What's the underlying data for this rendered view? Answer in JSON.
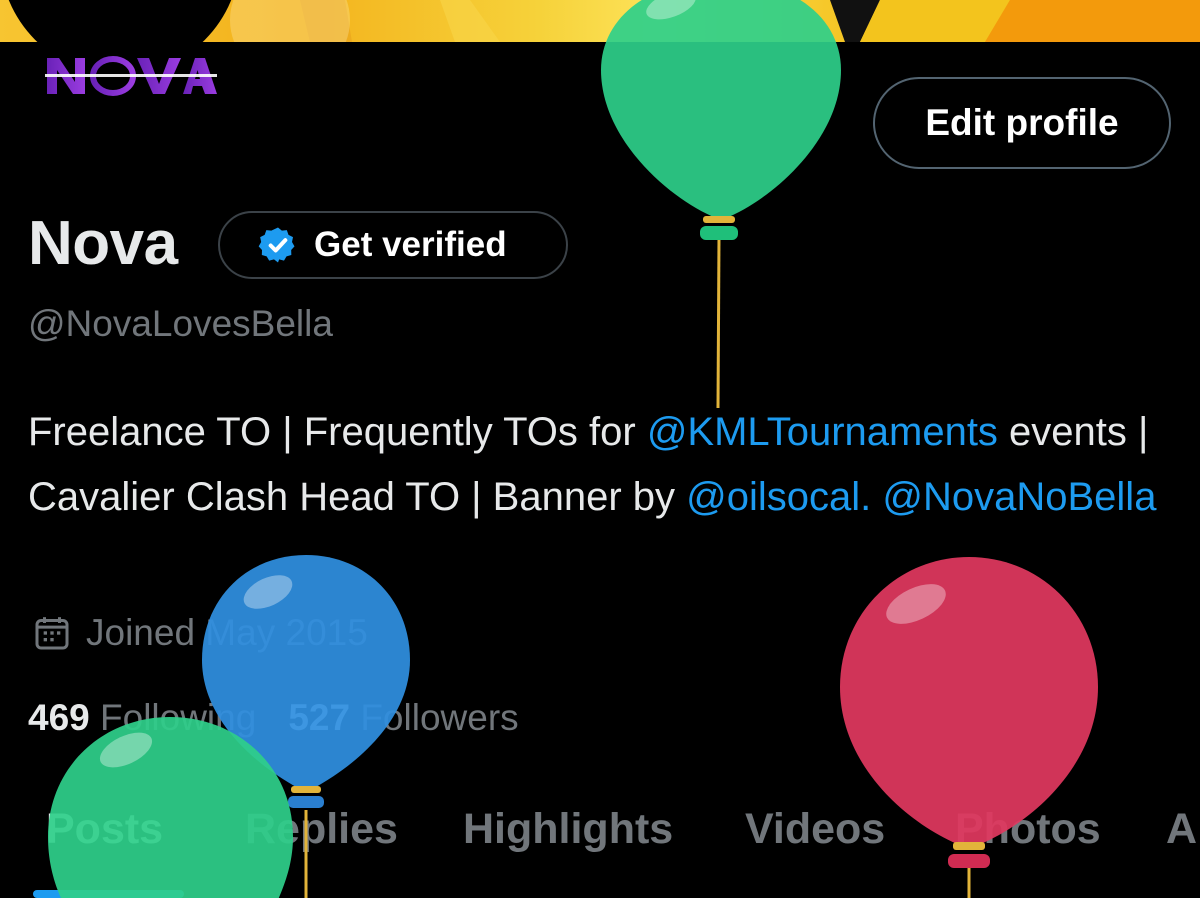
{
  "profile": {
    "display_name": "Nova",
    "handle": "@NovaLovesBella",
    "logo_text": "NOVA",
    "edit_profile_label": "Edit profile",
    "verify_label": "Get verified",
    "bio": {
      "text_1": "Freelance TO | Frequently TOs for ",
      "mention_1": "@KMLTournaments",
      "text_2": " events | Cavalier Clash Head TO | Banner by ",
      "mention_2": "@oilsocal",
      "text_3": ". ",
      "mention_3": "@NovaNoBella"
    },
    "joined": "Joined May 2015",
    "following_count": "469",
    "following_label": "Following",
    "followers_count": "527",
    "followers_label": "Followers"
  },
  "tabs": [
    {
      "label": "Posts",
      "active": true
    },
    {
      "label": "Replies",
      "active": false
    },
    {
      "label": "Highlights",
      "active": false
    },
    {
      "label": "Videos",
      "active": false
    },
    {
      "label": "Photos",
      "active": false
    },
    {
      "label": "A",
      "active": false
    }
  ],
  "icons": {
    "verified": "verified-badge-icon",
    "calendar": "calendar-icon",
    "balloons": [
      "green-balloon",
      "blue-balloon",
      "green-balloon",
      "red-balloon"
    ]
  },
  "colors": {
    "accent": "#1d9bf0",
    "muted": "#71767b",
    "text": "#e7e9ea",
    "logo_purple": "#7b2fc8",
    "balloon_green": "#2ecf8a",
    "balloon_blue": "#2f8fe0",
    "balloon_red": "#e0385f"
  }
}
